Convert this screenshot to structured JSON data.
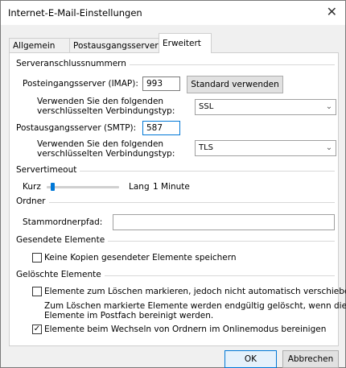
{
  "window": {
    "title": "Internet-E-Mail-Einstellungen",
    "close_icon": "close-icon"
  },
  "tabs": [
    {
      "label": "Allgemein"
    },
    {
      "label": "Postausgangsserver"
    },
    {
      "label": "Erweitert",
      "active": true
    }
  ],
  "server_ports": {
    "section_title": "Serveranschlussnummern",
    "incoming_label": "Posteingangsserver (IMAP):",
    "incoming_value": "993",
    "default_button": "Standard verwenden",
    "incoming_encryption_label_1": "Verwenden Sie den folgenden",
    "incoming_encryption_label_2": "verschlüsselten Verbindungstyp:",
    "incoming_encryption_value": "SSL",
    "outgoing_label": "Postausgangsserver (SMTP):",
    "outgoing_value": "587",
    "outgoing_encryption_label_1": "Verwenden Sie den folgenden",
    "outgoing_encryption_label_2": "verschlüsselten Verbindungstyp:",
    "outgoing_encryption_value": "TLS"
  },
  "timeout": {
    "section_title": "Servertimeout",
    "short_label": "Kurz",
    "long_label": "Lang",
    "value_text": "1 Minute",
    "slider_level": 0.05
  },
  "folders": {
    "section_title": "Ordner",
    "root_label": "Stammordnerpfad:",
    "root_value": ""
  },
  "sent_items": {
    "section_title": "Gesendete Elemente",
    "no_copies_label": "Keine Kopien gesendeter Elemente speichern",
    "no_copies_checked": false
  },
  "deleted_items": {
    "section_title": "Gelöschte Elemente",
    "mark_label": "Elemente zum Löschen markieren, jedoch nicht automatisch verschieben",
    "mark_checked": false,
    "note_line_1": "Zum Löschen markierte Elemente werden endgültig gelöscht, wenn die",
    "note_line_2": "Elemente im Postfach bereinigt werden.",
    "purge_label": "Elemente beim Wechseln von Ordnern im Onlinemodus bereinigen",
    "purge_checked": true
  },
  "footer": {
    "ok_label": "OK",
    "cancel_label": "Abbrechen"
  },
  "colors": {
    "accent": "#0078d7",
    "checkbox_border": "#333333"
  }
}
